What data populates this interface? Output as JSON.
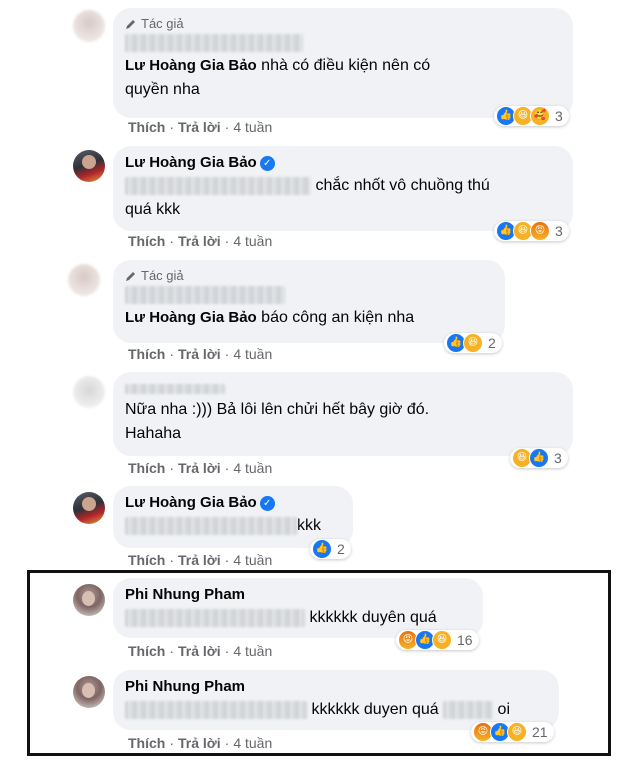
{
  "actions": {
    "like": "Thích",
    "reply": "Trả lời",
    "separator": "·"
  },
  "author_tag": "Tác giả",
  "comments": [
    {
      "author_hidden": true,
      "author_tag": true,
      "mention": "Lư Hoàng Gia Bảo",
      "text_line1": " nhà có điều kiện nên có",
      "text_line2": "quyền nha",
      "time": "4 tuần",
      "reactions": [
        "like",
        "haha",
        "care"
      ],
      "reaction_count": "3"
    },
    {
      "author": "Lư Hoàng Gia Bảo",
      "verified": true,
      "text_line1": "chắc nhốt vô chuồng thú",
      "text_line2": "quá kkk",
      "time": "4 tuần",
      "reactions": [
        "like",
        "haha",
        "angry"
      ],
      "reaction_count": "3"
    },
    {
      "author_hidden": true,
      "author_tag": true,
      "mention": "Lư Hoàng Gia Bảo",
      "text_line1": " báo công an kiện nha",
      "time": "4 tuần",
      "reactions": [
        "like",
        "haha"
      ],
      "reaction_count": "2"
    },
    {
      "author_hidden": true,
      "text_line1": "Nữa nha :))) Bả lôi lên chửi hết bây giờ đó.",
      "text_line2": "Hahaha",
      "time": "4 tuần",
      "reactions": [
        "haha",
        "like"
      ],
      "reaction_count": "3"
    },
    {
      "author": "Lư Hoàng Gia Bảo",
      "verified": true,
      "text_line1": "kkk",
      "time": "4 tuần",
      "reactions": [
        "like"
      ],
      "reaction_count": "2"
    },
    {
      "author": "Phi Nhung Pham",
      "text_line1": "kkkkkk duyên quá",
      "time": "4 tuần",
      "reactions": [
        "angry",
        "like",
        "haha"
      ],
      "reaction_count": "16"
    },
    {
      "author": "Phi Nhung Pham",
      "text_line1": "kkkkkk duyen quá",
      "text_suffix": "oi",
      "time": "4 tuần",
      "reactions": [
        "angry",
        "like",
        "haha"
      ],
      "reaction_count": "21"
    }
  ],
  "colors": {
    "bubble": "#f0f2f5",
    "secondary_text": "#65676b",
    "like_blue": "#1877f2",
    "haha_yellow": "#f7b125",
    "highlight_border": "#111111"
  }
}
